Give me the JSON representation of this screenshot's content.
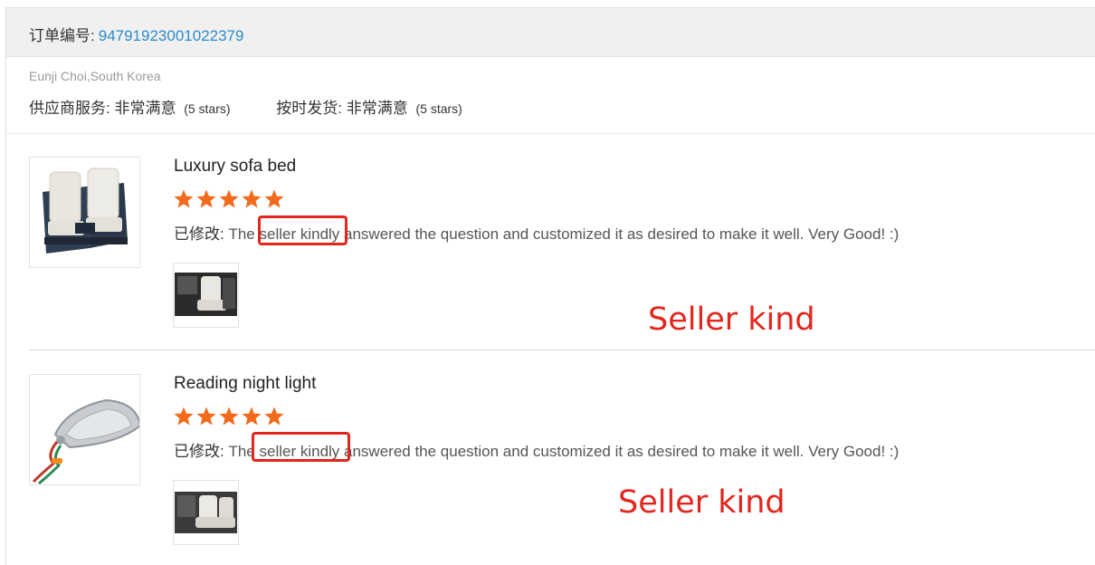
{
  "order": {
    "label": "订单编号:",
    "number": "94791923001022379"
  },
  "buyer": "Eunji Choi,South Korea",
  "ratings": {
    "supplier_service_label": "供应商服务:",
    "supplier_service_value": "非常满意",
    "supplier_service_stars": "(5 stars)",
    "on_time_label": "按时发货:",
    "on_time_value": "非常满意",
    "on_time_stars": "(5 stars)"
  },
  "items": [
    {
      "title": "Luxury sofa bed",
      "rating": 5,
      "modified_label": "已修改:",
      "review": "The seller kindly answered the question and customized it as desired to make it well. Very Good! :)",
      "annotation": "Seller kind"
    },
    {
      "title": "Reading night light",
      "rating": 5,
      "modified_label": "已修改:",
      "review": "The seller kindly answered the question and customized it as desired to make it well. Very Good! :)",
      "annotation": "Seller kind"
    }
  ],
  "colors": {
    "order_number": "#2e8bc9",
    "star": "#f26a1b",
    "annotation": "#e2261d"
  }
}
